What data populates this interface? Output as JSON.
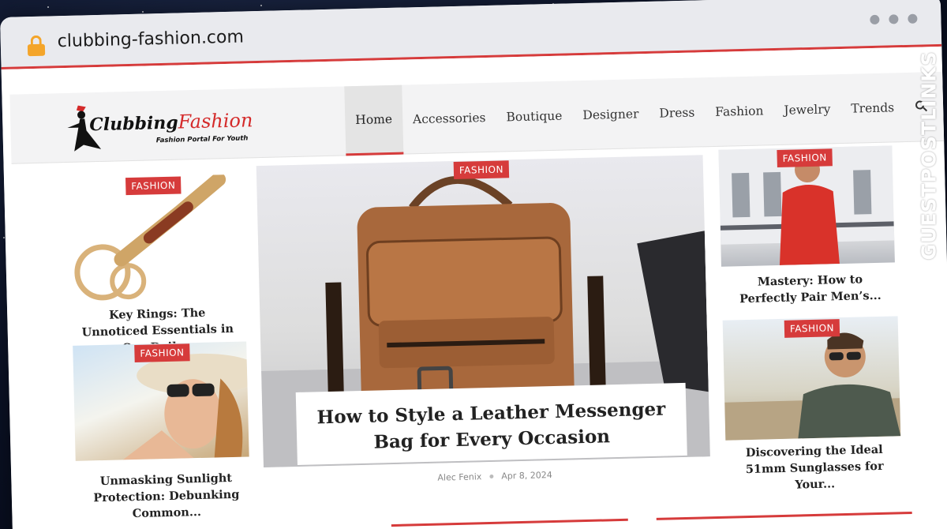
{
  "browser": {
    "url": "clubbing-fashion.com"
  },
  "site": {
    "logo": {
      "name_part1": "Clubbing",
      "name_part2": "Fashion",
      "tagline": "Fashion Portal For Youth"
    },
    "nav": [
      {
        "label": "Home"
      },
      {
        "label": "Accessories"
      },
      {
        "label": "Boutique"
      },
      {
        "label": "Designer"
      },
      {
        "label": "Dress"
      },
      {
        "label": "Fashion"
      },
      {
        "label": "Jewelry"
      },
      {
        "label": "Trends"
      }
    ],
    "accent_color": "#d63b3b"
  },
  "articles": {
    "left_top": {
      "category": "FASHION",
      "title": "Key Rings: The Unnoticed Essentials in Our Daily..."
    },
    "left_bottom": {
      "category": "FASHION",
      "title": "Unmasking Sunlight Protection: Debunking Common..."
    },
    "hero": {
      "category": "FASHION",
      "title": "How to Style a Leather Messenger Bag for Every Occasion",
      "author": "Alec Fenix",
      "date": "Apr 8, 2024"
    },
    "right_top": {
      "category": "FASHION",
      "title": "Mastery: How to Perfectly Pair Men’s..."
    },
    "right_bottom": {
      "category": "FASHION",
      "title": "Discovering the Ideal 51mm Sunglasses for Your..."
    }
  },
  "watermark": {
    "text": "GUESTPOSTLINKS"
  }
}
